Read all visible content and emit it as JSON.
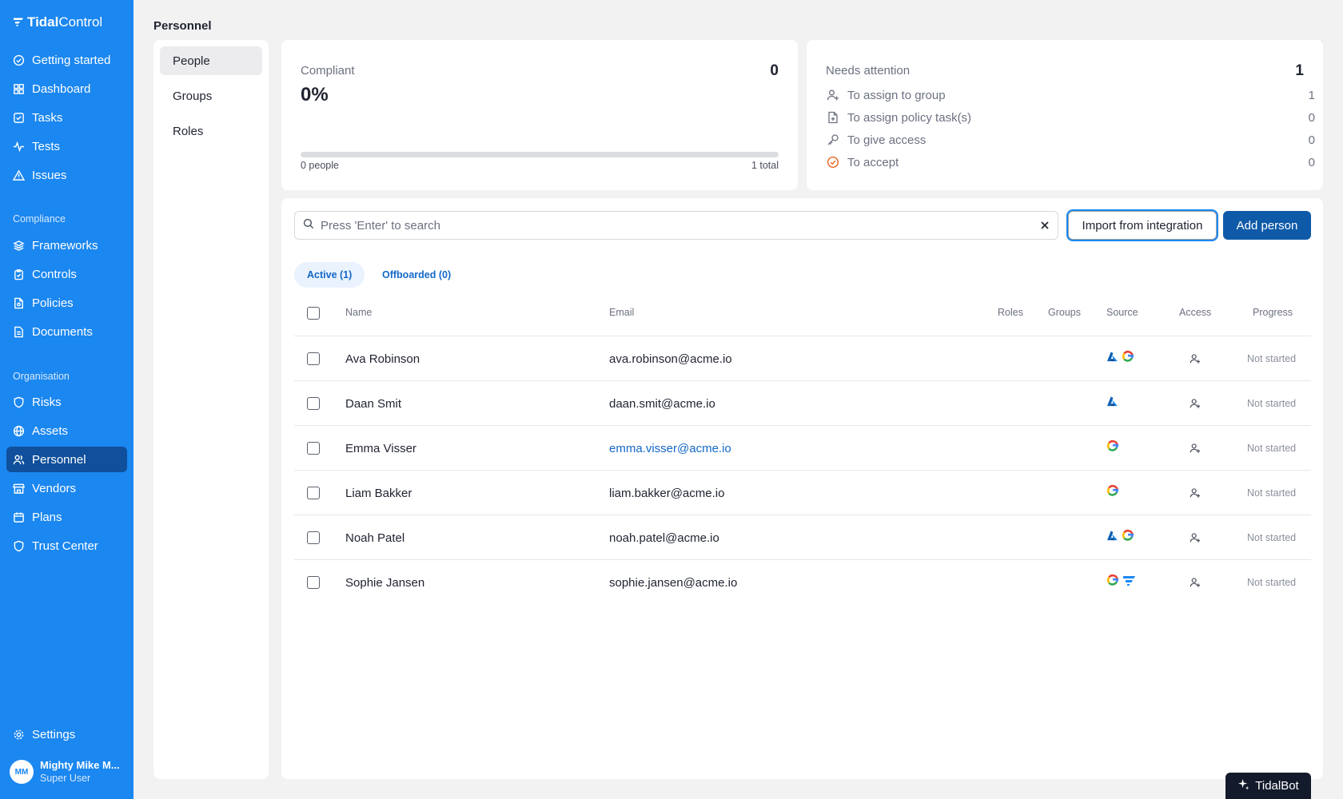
{
  "brand": {
    "name_bold": "Tidal",
    "name_light": "Control",
    "accent": "#1b87f0"
  },
  "sidebar": {
    "main_items": [
      {
        "label": "Getting started",
        "icon": "check-circle-icon"
      },
      {
        "label": "Dashboard",
        "icon": "dashboard-icon"
      },
      {
        "label": "Tasks",
        "icon": "task-icon"
      },
      {
        "label": "Tests",
        "icon": "pulse-icon"
      },
      {
        "label": "Issues",
        "icon": "warning-icon"
      }
    ],
    "compliance_label": "Compliance",
    "compliance_items": [
      {
        "label": "Frameworks",
        "icon": "layers-icon"
      },
      {
        "label": "Controls",
        "icon": "clipboard-icon"
      },
      {
        "label": "Policies",
        "icon": "file-icon"
      },
      {
        "label": "Documents",
        "icon": "document-icon"
      }
    ],
    "organisation_label": "Organisation",
    "organisation_items": [
      {
        "label": "Risks",
        "icon": "shield-icon"
      },
      {
        "label": "Assets",
        "icon": "globe-icon"
      },
      {
        "label": "Personnel",
        "icon": "users-icon"
      },
      {
        "label": "Vendors",
        "icon": "store-icon"
      },
      {
        "label": "Plans",
        "icon": "calendar-icon"
      },
      {
        "label": "Trust Center",
        "icon": "shield-icon"
      }
    ],
    "settings_label": "Settings",
    "user": {
      "initials": "MM",
      "name": "Mighty Mike M...",
      "role": "Super User"
    }
  },
  "page": {
    "title": "Personnel"
  },
  "subnav": {
    "items": [
      "People",
      "Groups",
      "Roles"
    ],
    "active": "People"
  },
  "compliant": {
    "label": "Compliant",
    "count": "0",
    "percent": "0%",
    "people_label": "0 people",
    "total_label": "1 total",
    "progress_fraction": 0
  },
  "attention": {
    "label": "Needs attention",
    "count": "1",
    "rows": [
      {
        "label": "To assign to group",
        "value": "1",
        "icon": "user-plus-icon"
      },
      {
        "label": "To assign policy task(s)",
        "value": "0",
        "icon": "file-plus-icon"
      },
      {
        "label": "To give access",
        "value": "0",
        "icon": "key-icon"
      },
      {
        "label": "To accept",
        "value": "0",
        "icon": "check-circle-icon"
      }
    ]
  },
  "search": {
    "placeholder": "Press 'Enter' to search"
  },
  "buttons": {
    "import": "Import from integration",
    "add": "Add person"
  },
  "tabs": [
    {
      "label": "Active (1)"
    },
    {
      "label": "Offboarded (0)"
    }
  ],
  "table": {
    "headers": {
      "name": "Name",
      "email": "Email",
      "roles": "Roles",
      "groups": "Groups",
      "source": "Source",
      "access": "Access",
      "progress": "Progress"
    },
    "rows": [
      {
        "name": "Ava Robinson",
        "email": "ava.robinson@acme.io",
        "sources": [
          "azure",
          "google"
        ],
        "progress": "Not started",
        "email_link": false
      },
      {
        "name": "Daan Smit",
        "email": "daan.smit@acme.io",
        "sources": [
          "azure"
        ],
        "progress": "Not started",
        "email_link": false
      },
      {
        "name": "Emma Visser",
        "email": "emma.visser@acme.io",
        "sources": [
          "google"
        ],
        "progress": "Not started",
        "email_link": true
      },
      {
        "name": "Liam Bakker",
        "email": "liam.bakker@acme.io",
        "sources": [
          "google"
        ],
        "progress": "Not started",
        "email_link": false
      },
      {
        "name": "Noah Patel",
        "email": "noah.patel@acme.io",
        "sources": [
          "azure",
          "google"
        ],
        "progress": "Not started",
        "email_link": false
      },
      {
        "name": "Sophie Jansen",
        "email": "sophie.jansen@acme.io",
        "sources": [
          "google",
          "tidal"
        ],
        "progress": "Not started",
        "email_link": false
      }
    ]
  },
  "tidalbot": {
    "label": "TidalBot"
  }
}
